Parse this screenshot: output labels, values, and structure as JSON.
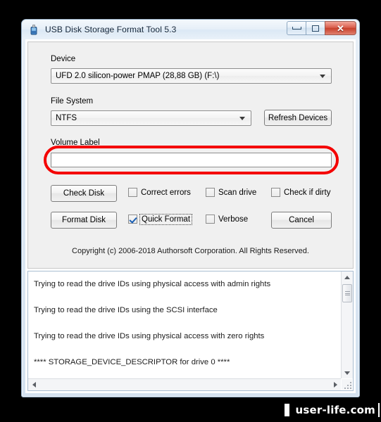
{
  "window": {
    "title": "USB Disk Storage Format Tool 5.3",
    "icon": "usb-drive-icon",
    "controls": {
      "minimize": "minimize-icon",
      "restore": "restore-icon",
      "close": "✕"
    }
  },
  "form": {
    "device": {
      "label": "Device",
      "value": "UFD 2.0  silicon-power  PMAP (28,88 GB) (F:\\)"
    },
    "file_system": {
      "label": "File System",
      "value": "NTFS"
    },
    "refresh_button": "Refresh Devices",
    "volume_label": {
      "label": "Volume Label",
      "value": "",
      "placeholder": "",
      "highlight_color": "#f40000"
    },
    "check_disk_button": "Check Disk",
    "format_disk_button": "Format Disk",
    "cancel_button": "Cancel",
    "checkboxes": [
      {
        "label": "Correct errors",
        "checked": false,
        "focused": false
      },
      {
        "label": "Scan drive",
        "checked": false,
        "focused": false
      },
      {
        "label": "Check if dirty",
        "checked": false,
        "focused": false
      },
      {
        "label": "Quick Format",
        "checked": true,
        "focused": true
      },
      {
        "label": "Verbose",
        "checked": false,
        "focused": false
      }
    ],
    "copyright": "Copyright (c) 2006-2018 Authorsoft Corporation. All Rights Reserved."
  },
  "log": {
    "lines": [
      "Trying to read the drive IDs using physical access with admin rights",
      "Trying to read the drive IDs using the SCSI interface",
      "Trying to read the drive IDs using physical access with zero rights",
      "**** STORAGE_DEVICE_DESCRIPTOR for drive 0 ****"
    ]
  },
  "watermark": {
    "text": "user-life.com"
  }
}
